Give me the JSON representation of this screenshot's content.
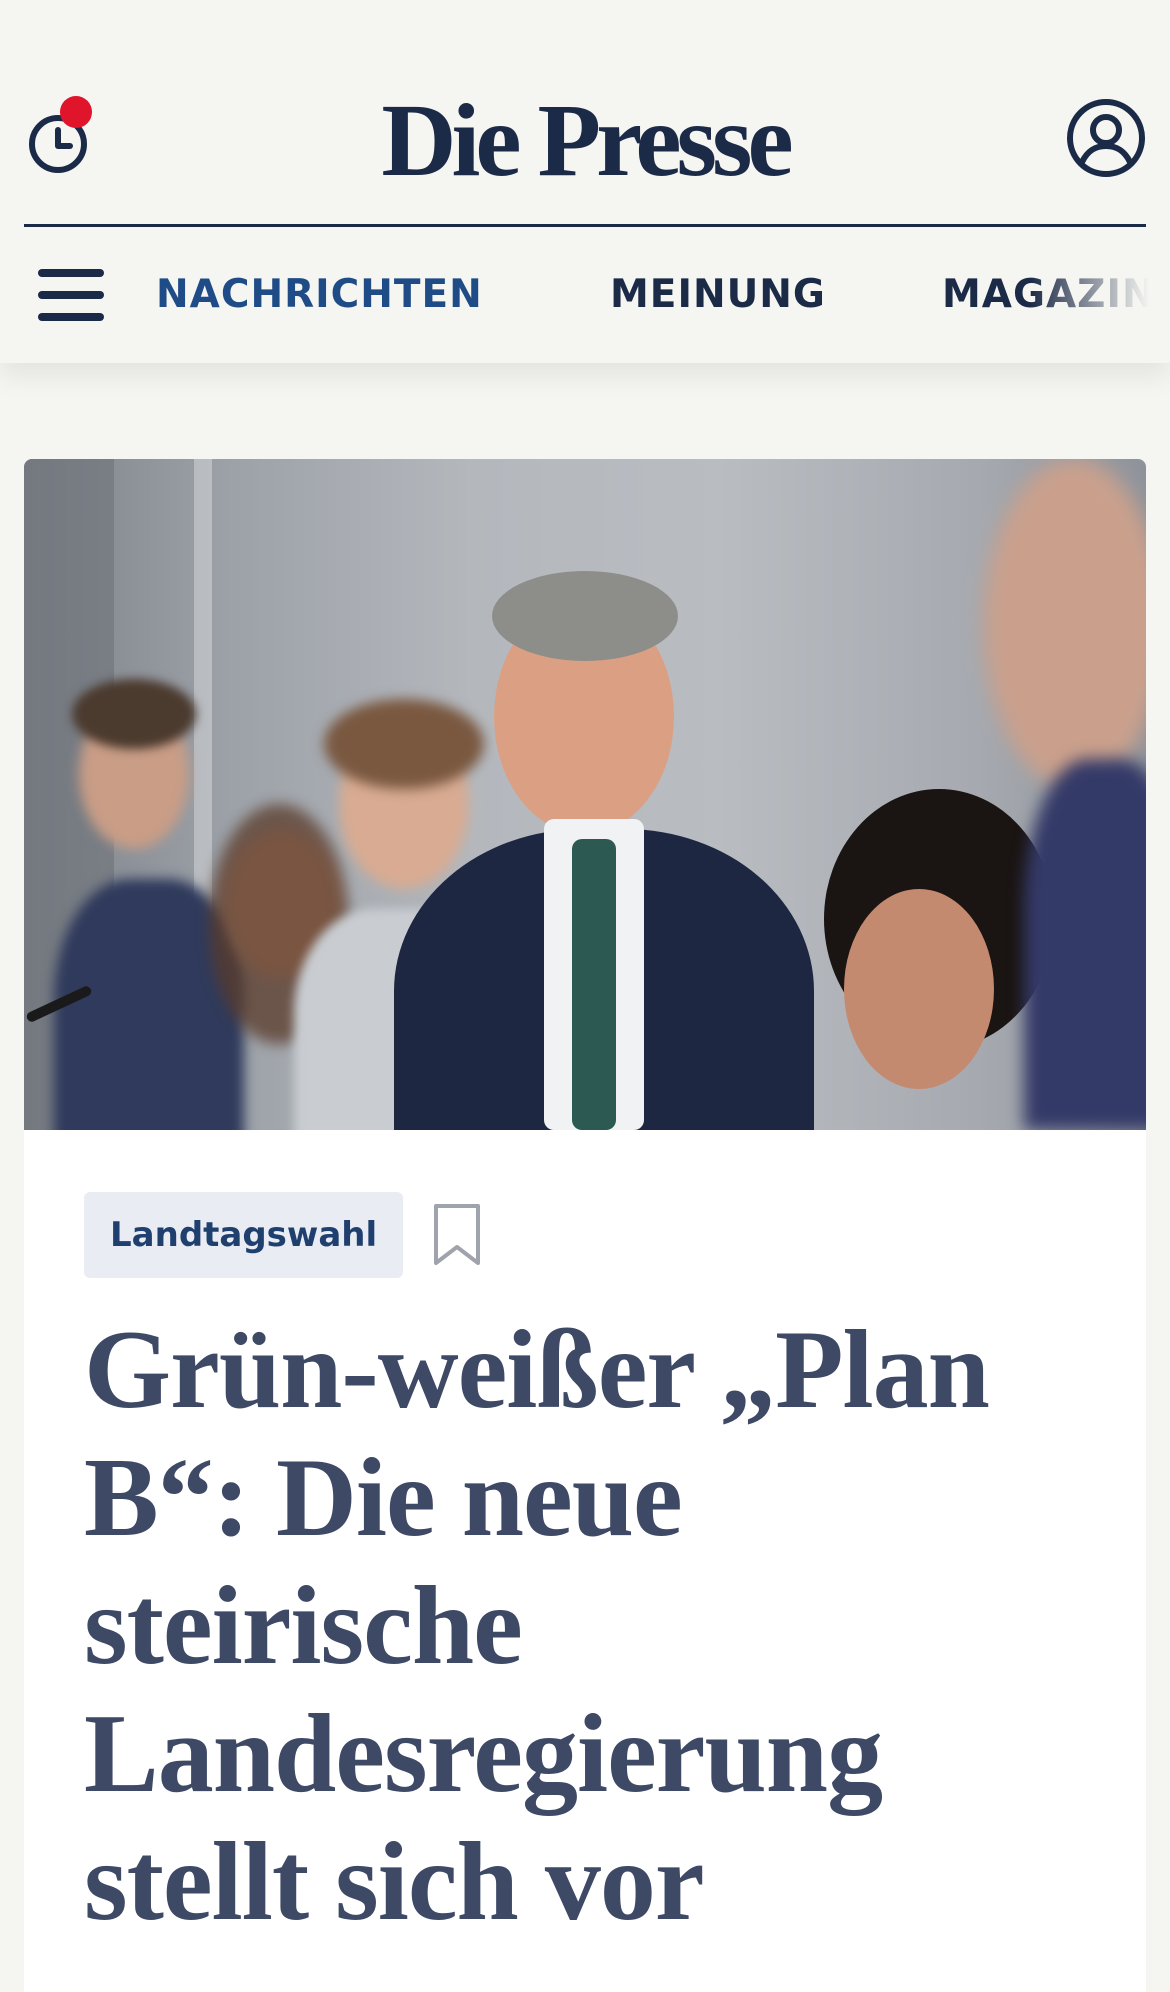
{
  "header": {
    "logo": "Die Presse",
    "history_icon": "history-clock-icon",
    "account_icon": "user-account-icon",
    "menu_icon": "hamburger-menu-icon",
    "nav": [
      "NACHRICHTEN",
      "MEINUNG",
      "MAGAZIN"
    ],
    "active_nav": "NACHRICHTEN",
    "notification_color": "#e0142a"
  },
  "article": {
    "tag": "Landtagswahl",
    "bookmark_icon": "bookmark-icon",
    "headline": "Grün-weißer „Plan B“: Die neue steirische Landesregierung stellt sich vor"
  },
  "colors": {
    "brand": "#1b2a46",
    "nav_active": "#1f4c86",
    "headline": "#3e4966",
    "tag_bg": "#e9edf3"
  }
}
